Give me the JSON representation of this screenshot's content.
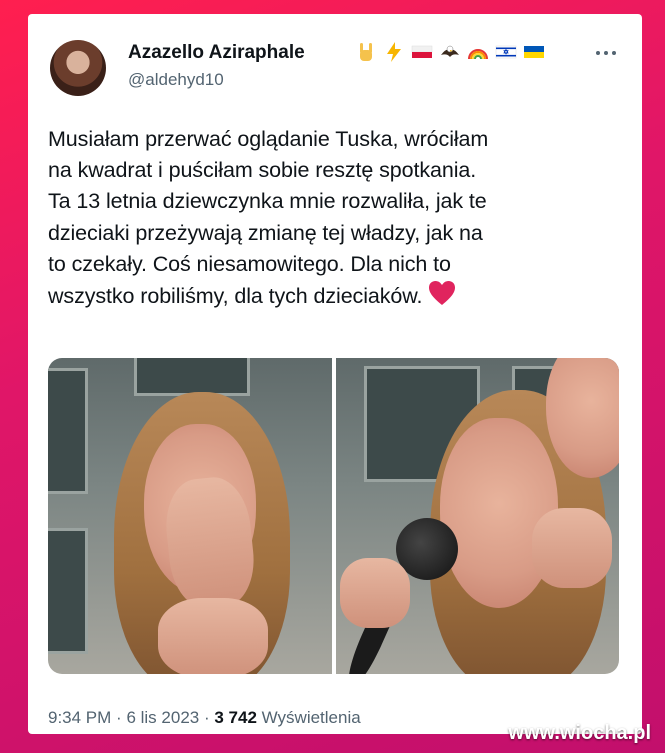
{
  "tweet": {
    "display_name": "Azazello Aziraphale",
    "handle": "@aldehyd10",
    "badges": [
      "metal-hand-icon",
      "lightning-icon",
      "poland-flag-icon",
      "eagle-icon",
      "rainbow-icon",
      "israel-flag-icon",
      "ukraine-flag-icon"
    ],
    "text": "Musiałam przerwać oglądanie Tuska, wróciłam\nna kwadrat i puściłam sobie resztę spotkania.\nTa 13 letnia dziewczynka mnie rozwaliła, jak te\ndzieciaki przeżywają zmianę tej władzy, jak na\nto czekały. Coś niesamowitego. Dla nich to\nwszystko robiliśmy, dla tych dzieciaków.",
    "time": "9:34 PM",
    "date": "6 lis 2023",
    "views_count": "3 742",
    "views_label": "Wyświetlenia"
  },
  "watermark": "www.wiocha.pl",
  "colors": {
    "accent_frame": "#e01668",
    "text": "#0f1419",
    "muted": "#536471",
    "heart": "#e0245e"
  }
}
